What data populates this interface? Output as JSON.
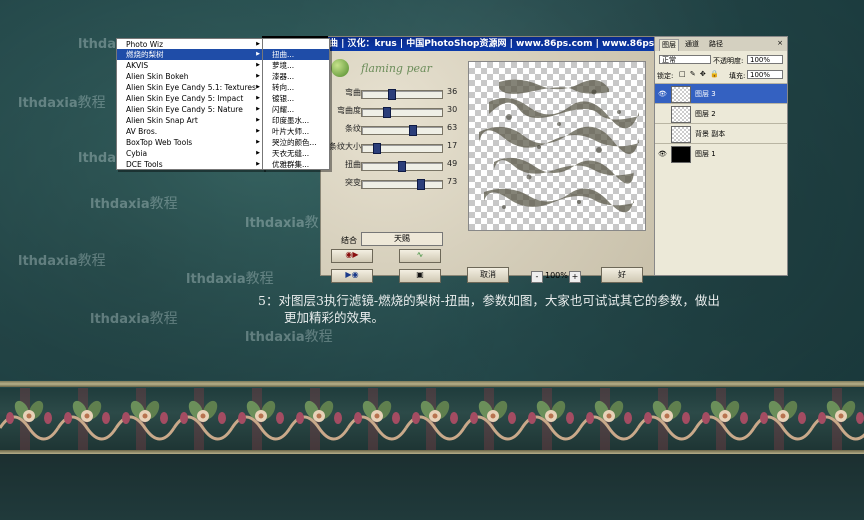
{
  "watermarks": [
    {
      "en": "lthdax",
      "cn": ""
    },
    {
      "en": "lthdaxia",
      "cn": "教程"
    },
    {
      "en": "lthdax",
      "cn": ""
    },
    {
      "en": "lthdaxia",
      "cn": "教程"
    },
    {
      "en": "lthdaxia",
      "cn": "教"
    },
    {
      "en": "lthdaxia",
      "cn": "教程"
    },
    {
      "en": "lthdaxia",
      "cn": "教程"
    },
    {
      "en": "lthdaxia",
      "cn": "教程"
    },
    {
      "en": "lthdaxia",
      "cn": "教程"
    }
  ],
  "menu": {
    "items": [
      {
        "label": "Photo Wiz",
        "arrow": "▶"
      },
      {
        "label": "燃烧的梨树",
        "arrow": "▶"
      },
      {
        "label": "AKVIS",
        "arrow": "▶"
      },
      {
        "label": "Alien Skin Bokeh",
        "arrow": "▶"
      },
      {
        "label": "Alien Skin Eye Candy 5.1: Textures",
        "arrow": "▶"
      },
      {
        "label": "Alien Skin Eye Candy 5: Impact",
        "arrow": "▶"
      },
      {
        "label": "Alien Skin Eye Candy 5: Nature",
        "arrow": "▶"
      },
      {
        "label": "Alien Skin Snap Art",
        "arrow": "▶"
      },
      {
        "label": "AV Bros.",
        "arrow": "▶"
      },
      {
        "label": "BoxTop Web Tools",
        "arrow": "▶"
      },
      {
        "label": "Cybia",
        "arrow": "▶"
      },
      {
        "label": "DCE Tools",
        "arrow": "▶"
      }
    ],
    "submenu": [
      "扭曲...",
      "萝境...",
      "漆器...",
      "转向...",
      "镀银...",
      "闪耀...",
      "印度墨水...",
      "叶片大师...",
      "哭泣的颜色...",
      "天衣无缝...",
      "优雅群集..."
    ]
  },
  "dialog": {
    "title": "曲 | 汉化：krus | 中国PhotoShop资源网 | www.86ps.com | www.86ps.cn",
    "logo_text": "flaming pear",
    "params": [
      {
        "label": "弯曲",
        "value": 36
      },
      {
        "label": "弯曲度",
        "value": 30
      },
      {
        "label": "条纹",
        "value": 63
      },
      {
        "label": "条纹大小",
        "value": 17
      },
      {
        "label": "扭曲",
        "value": 49
      },
      {
        "label": "突变",
        "value": 73
      }
    ],
    "combine_label": "结合",
    "combine_value": "天赐",
    "buttons": {
      "cancel": "取消",
      "ok": "好"
    },
    "zoom": {
      "minus": "-",
      "value": "100%",
      "plus": "+"
    }
  },
  "layers": {
    "tabs": [
      "图层",
      "通道",
      "路径"
    ],
    "close": "×",
    "blend_mode": "正常",
    "opacity_label": "不透明度:",
    "opacity": "100%",
    "lock_label": "锁定:",
    "fill_label": "填充:",
    "fill": "100%",
    "list": [
      {
        "name": "图层 3",
        "visible": true,
        "selected": true,
        "thumb": "checker"
      },
      {
        "name": "图层 2",
        "visible": false,
        "selected": false,
        "thumb": "checker"
      },
      {
        "name": "背景 副本",
        "visible": false,
        "selected": false,
        "thumb": "checker"
      },
      {
        "name": "图层 1",
        "visible": true,
        "selected": false,
        "thumb": "black"
      }
    ]
  },
  "caption": {
    "line1": "5：对图层3执行滤镜-燃烧的梨树-扭曲，参数如图，大家也可试试其它的参数，做出",
    "line2": "更加精彩的效果。"
  },
  "icons": {
    "eye": "eye-icon",
    "arrow": "arrow-right-icon"
  }
}
